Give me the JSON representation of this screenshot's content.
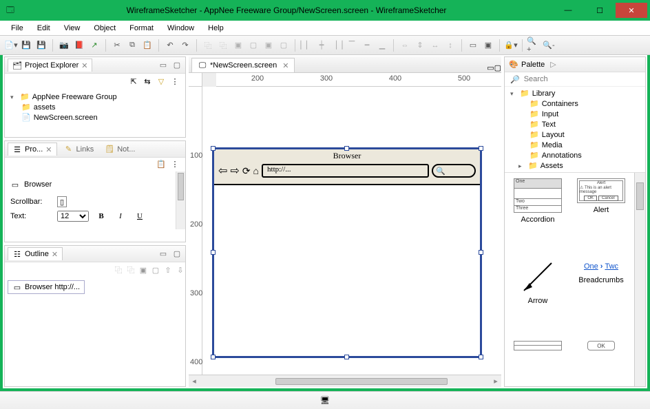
{
  "window": {
    "title": "WireframeSketcher - AppNee Freeware Group/NewScreen.screen - WireframeSketcher"
  },
  "menu": {
    "items": [
      "File",
      "Edit",
      "View",
      "Object",
      "Format",
      "Window",
      "Help"
    ]
  },
  "projectExplorer": {
    "title": "Project Explorer",
    "root": "AppNee Freeware Group",
    "children": [
      "assets",
      "NewScreen.screen"
    ]
  },
  "propsTabs": {
    "active": "Pro...",
    "inactive": [
      "Links",
      "Not..."
    ]
  },
  "properties": {
    "heading": "Browser",
    "scrollbarLabel": "Scrollbar:",
    "textLabel": "Text:",
    "fontSize": "12"
  },
  "outline": {
    "title": "Outline",
    "item": "Browser http://..."
  },
  "editor": {
    "tab": "*NewScreen.screen",
    "rulerH": [
      "200",
      "300",
      "400",
      "500"
    ],
    "rulerV": [
      "100",
      "200",
      "300",
      "400"
    ],
    "browser": {
      "title": "Browser",
      "url": "http://..."
    }
  },
  "palette": {
    "title": "Palette",
    "searchPlaceholder": "Search",
    "library": "Library",
    "categories": [
      "Containers",
      "Input",
      "Text",
      "Layout",
      "Media",
      "Annotations"
    ],
    "assets": "Assets",
    "items": [
      "Accordion",
      "Alert",
      "Arrow",
      "Breadcrumbs"
    ],
    "breadcrumbSample": [
      "One",
      "Twc"
    ]
  }
}
